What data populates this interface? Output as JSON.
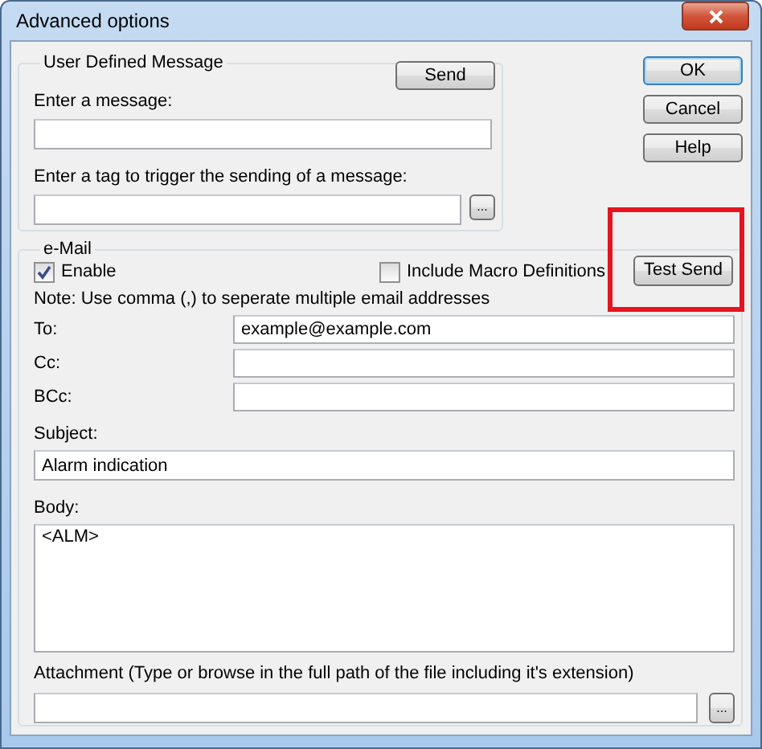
{
  "window": {
    "title": "Advanced options"
  },
  "user_defined_message": {
    "title": "User Defined Message",
    "send_button": "Send",
    "message_label": "Enter a message:",
    "tag_label": "Enter a tag to trigger the sending of a message:",
    "browse_button": "..."
  },
  "dialog_buttons": [
    {
      "label": "OK",
      "default": true
    },
    {
      "label": "Cancel",
      "default": false
    },
    {
      "label": "Help",
      "default": false
    }
  ],
  "email": {
    "title": "e-Mail",
    "enable": {
      "label": "Enable",
      "checked": true
    },
    "include_macros": {
      "label": "Include Macro Definitions",
      "checked": false
    },
    "test_send_button": {
      "label": "Test Send",
      "highlighted": true
    },
    "note": "Note: Use comma (,) to seperate multiple email addresses",
    "recipients": [
      {
        "label": "To:",
        "value": "example@example.com"
      },
      {
        "label": "Cc:"
      },
      {
        "label": "BCc:"
      }
    ],
    "subject": {
      "label": "Subject:",
      "value": "Alarm indication"
    },
    "body": {
      "label": "Body:",
      "value": "<ALM>"
    },
    "attachment": {
      "label": "Attachment (Type or browse in the full path of the file including it's extension)",
      "browse_button": "..."
    }
  }
}
